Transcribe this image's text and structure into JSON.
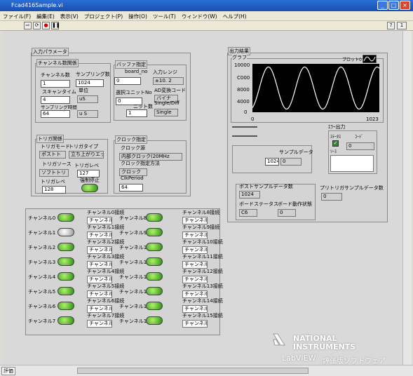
{
  "window": {
    "title": "Fcad416Sample.vi"
  },
  "menu": [
    "ファイル(F)",
    "編集(E)",
    "表示(V)",
    "プロジェクト(P)",
    "操作(O)",
    "ツール(T)",
    "ウィンドウ(W)",
    "ヘルプ(H)"
  ],
  "input_params": {
    "title": "入力パラメータ",
    "channel": {
      "title": "チャンネル数関係",
      "count_label": "チャンネル数",
      "count": "1",
      "sampling_label": "サンプリング数",
      "sampling": "1024",
      "scan_label": "スキャンタイム",
      "scan": "4",
      "unit_label": "単位",
      "unit1": "uS",
      "sampling_time_label": "サンプリング時間",
      "sampling_time": "64",
      "unit2": "u S"
    },
    "buffer": {
      "title": "バッファ指定",
      "board_label": "board_no",
      "board": "0",
      "range_label": "入力レンジ",
      "range": "±10. 2",
      "select_label": "選択ユニットNo",
      "select": "0",
      "ad_label": "AD変換コード",
      "ad": "バイナ",
      "sd_label": "Single/Diff",
      "unit_count_label": "ニット数",
      "unit_count": "1",
      "sd": "Single"
    },
    "trigger": {
      "title": "トリガ関係",
      "mode_label": "トリガモード",
      "type_label": "トリガタイプ",
      "mode": "ポストト",
      "type": "立ち上がりエッ",
      "source_label": "トリガソース",
      "source": "ソフトトリ",
      "level_label": "トリガレベ",
      "level": "127",
      "level2_label": "トリガレベ",
      "level2": "128",
      "stop_label": "強制停止"
    },
    "clock": {
      "title": "クロック指定",
      "source_label": "クロック源",
      "source": "内部クロック(20MHz",
      "method_label": "クロック指定方法",
      "method": "クロック",
      "period_label": "ClkPeriod",
      "period": "64"
    }
  },
  "output": {
    "title": "出力結果",
    "graph_label": "グラフ",
    "plot_label": "プロット0",
    "yticks": [
      "10000",
      "C000",
      "8000",
      "4000",
      "0"
    ],
    "xticks": [
      "0",
      "1023"
    ],
    "sample_label": "サンプルデータ",
    "sample_index": "1024",
    "sample_value": "0",
    "error": {
      "title": "ｴﾗｰ出力",
      "status_label": "ｽﾃｰﾀｽ",
      "code_label": "ｺｰﾄﾞ",
      "code": "0",
      "source_label": "ｿｰｽ"
    },
    "post_label": "ポストサンプルデータ数",
    "post": "1024",
    "status_label": "ボードステータス",
    "status": "C6",
    "motion_label": "ボード動作状態",
    "motion": "0",
    "pre_label": "プリトリガサンプルデータ数",
    "pre": "0"
  },
  "channels_left": [
    {
      "led": "チャンネル0",
      "sel": "チャンネル0接続",
      "val": "チャンネル"
    },
    {
      "led": "チャンネル1",
      "sel": "チャンネル1接続",
      "val": "チャンネル"
    },
    {
      "led": "チャンネル2",
      "sel": "チャンネル2接続",
      "val": "チャンネル"
    },
    {
      "led": "チャンネル3",
      "sel": "チャンネル3接続",
      "val": "チャンネル"
    },
    {
      "led": "チャンネル4",
      "sel": "チャンネル4接続",
      "val": "チャンネル"
    },
    {
      "led": "チャンネル5",
      "sel": "チャンネル5接続",
      "val": "チャンネル"
    },
    {
      "led": "チャンネル6",
      "sel": "チャンネル6接続",
      "val": "チャンネル"
    },
    {
      "led": "チャンネル7",
      "sel": "チャンネル7接続",
      "val": "チャンネル"
    }
  ],
  "channels_right": [
    {
      "led": "チャンネル8",
      "sel": "チャンネル8接続",
      "val": "チャンネル"
    },
    {
      "led": "チャンネル9",
      "sel": "チャンネル9接続",
      "val": "チャンネル"
    },
    {
      "led": "チャンネル10",
      "sel": "チャンネル10接続",
      "val": "チャンネル"
    },
    {
      "led": "チャンネル11",
      "sel": "チャンネル11接続",
      "val": "チャンネル"
    },
    {
      "led": "チャンネル12",
      "sel": "チャンネル12接続",
      "val": "チャンネル"
    },
    {
      "led": "チャンネル13",
      "sel": "チャンネル13接続",
      "val": "チャンネル"
    },
    {
      "led": "チャンネル14",
      "sel": "チャンネル14接続",
      "val": "チャンネル"
    },
    {
      "led": "チャンネル15",
      "sel": "チャンネル15接続",
      "val": "チャンネル"
    }
  ],
  "logo": {
    "line1": "NATIONAL",
    "line2": "INSTRUMENTS",
    "line3": "LabVIEW",
    "line4": "評価版ソフトウェア"
  },
  "status_bar": {
    "label": "評価"
  }
}
